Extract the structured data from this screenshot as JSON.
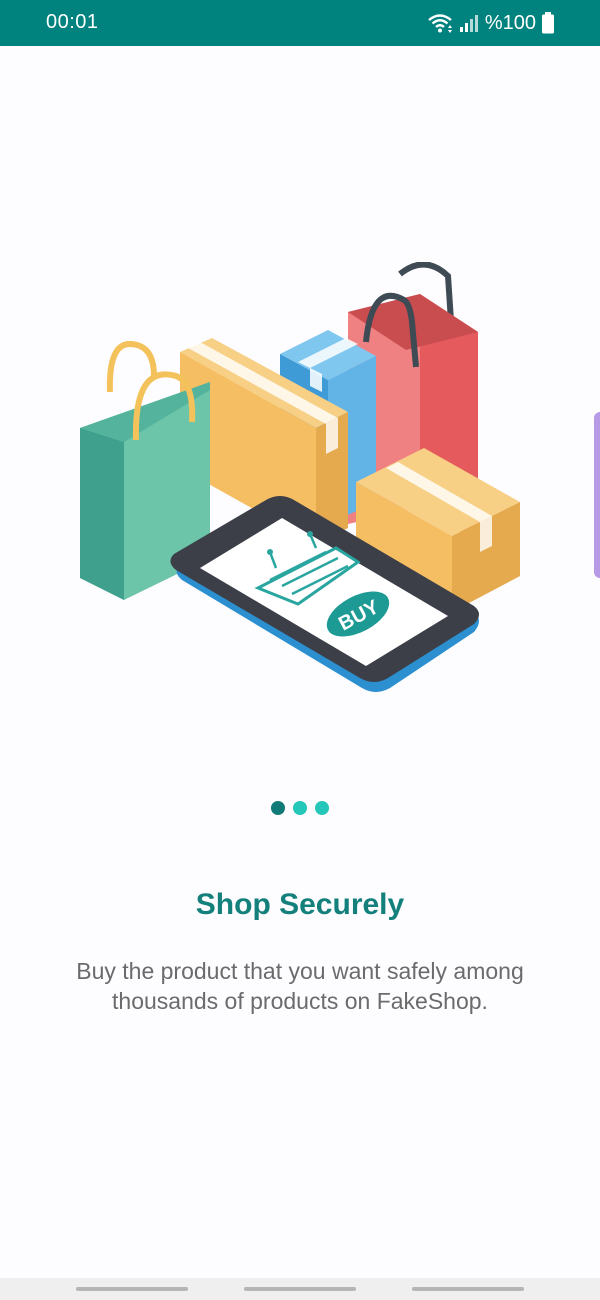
{
  "status_bar": {
    "time": "00:01",
    "battery": "%100",
    "icons": [
      "wifi-icon",
      "signal-icon",
      "battery-icon"
    ],
    "background": "#00827e"
  },
  "illustration": {
    "buy_label": "BUY",
    "icon": "shopping-illustration"
  },
  "onboarding": {
    "page_index": 1,
    "page_count": 3,
    "title": "Shop Securely",
    "description": "Buy the product that you want safely among thousands of products on FakeShop."
  },
  "colors": {
    "accent": "#14807b",
    "dot_active": "#0f7a76",
    "dot_inactive": "#25c8b8"
  }
}
